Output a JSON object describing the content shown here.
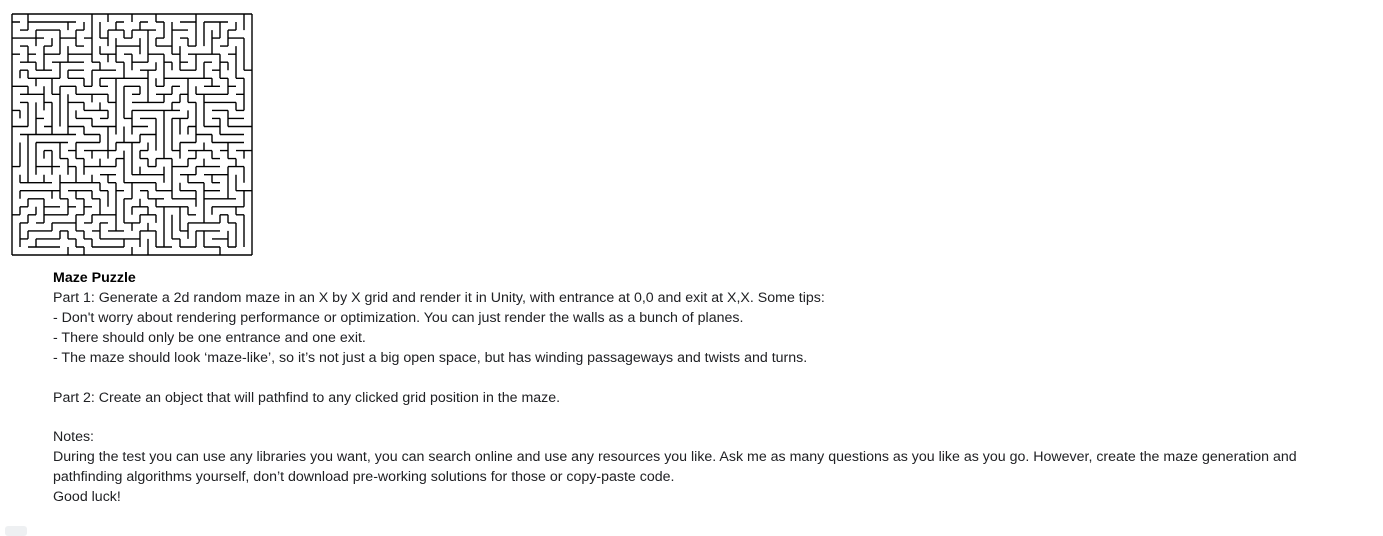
{
  "maze_image": {
    "description": "maze illustration",
    "line_color": "#000000"
  },
  "document": {
    "title": "Maze Puzzle",
    "part1": {
      "intro": "Part 1: Generate a 2d random maze in an X by X grid and render it in Unity, with entrance at 0,0 and exit at X,X.  Some tips:",
      "tips": [
        "- Don't worry about rendering performance or optimization. You can just render the walls as a bunch of planes.",
        "- There should only be one entrance and one exit.",
        "- The maze should look ‘maze-like’, so it’s not just a big open space, but has winding passageways and twists and turns."
      ]
    },
    "part2": "Part 2: Create an object that will pathfind to any clicked grid position in the maze.",
    "notes_heading": "Notes:",
    "notes_body": "During the test you can use any libraries you want, you can search online and use any resources you like.  Ask me as many questions as you like as you go.   However, create the maze generation and pathfinding algorithms yourself, don’t download pre-working solutions for those or copy-paste code.",
    "closing": "Good luck!"
  }
}
